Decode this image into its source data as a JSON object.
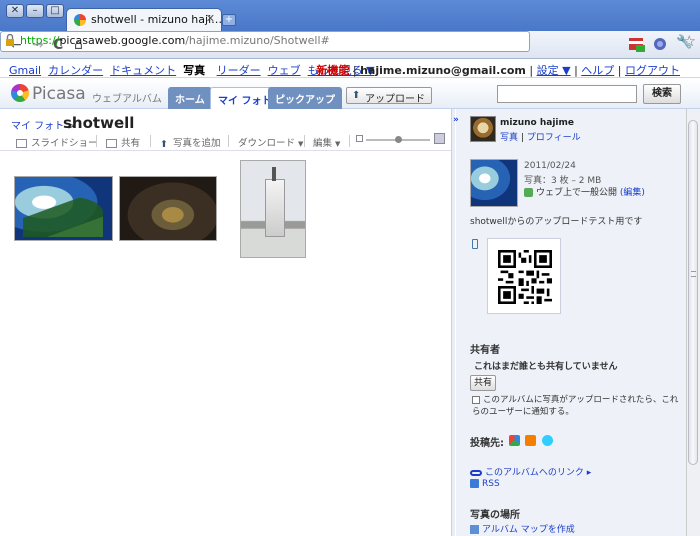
{
  "browser": {
    "tab_title": "shotwell - mizuno haji…",
    "tab_close": "✕",
    "new_tab": "+",
    "win_close": "✕",
    "win_min": "–",
    "win_max": "□",
    "back": "←",
    "forward": "→",
    "reload": "C",
    "home": "⌂",
    "url_scheme": "https://",
    "url_host": "picasaweb.google.com",
    "url_path": "/hajime.mizuno/Shotwell#",
    "star": "☆",
    "wrench": "🔧"
  },
  "gbar": {
    "links": [
      "Gmail",
      "カレンダー",
      "ドキュメント"
    ],
    "current": "写真",
    "links2": [
      "リーダー",
      "ウェブ"
    ],
    "more": "もっと見る ▼",
    "new_features": "新機能",
    "email": "hajime.mizuno@gmail.com",
    "settings": "設定 ▼",
    "help": "ヘルプ",
    "logout": "ログアウト",
    "sep": "|"
  },
  "picasa": {
    "logo_text": "Picasa",
    "subtitle": "ウェブアルバム",
    "tabs": [
      "ホーム",
      "マイ フォト",
      "ピックアップ"
    ],
    "upload_label": "アップロード",
    "upload_icon": "⬆",
    "search_button": "検索",
    "search_value": ""
  },
  "album": {
    "breadcrumb": "マイ フォト",
    "breadcrumb_sep": ">",
    "title": "shotwell",
    "actions": {
      "slideshow": "スライドショー",
      "share": "共有",
      "add_photos": "写真を追加",
      "download": "ダウンロード",
      "edit": "編集"
    },
    "dropdown_arrow": "▼",
    "thumb_size_level": 0.5
  },
  "side": {
    "collapse": "»",
    "owner_name": "mizuno hajime",
    "owner_photos": "写真",
    "owner_profile": "プロフィール",
    "date": "2011/02/24",
    "count": "写真：3 枚 – 2 MB",
    "visibility": "ウェブ上で一般公開",
    "visibility_edit": "(編集)",
    "description": "shotwellからのアップロードテスト用です",
    "sharing_header": "共有者",
    "not_shared": "これはまだ誰とも共有していません",
    "share_button": "共有",
    "notify_text": "このアルバムに写真がアップロードされたら、これらのユーザーに通知する。",
    "post_to": "投稿先:",
    "album_link": "このアルバムへのリンク ▸",
    "rss": "RSS",
    "location_header": "写真の場所",
    "create_map": "アルバム マップを作成"
  },
  "colors": {
    "link": "#1a3ecb",
    "new_features": "#cc0000",
    "url_secure": "#00aa00",
    "chrome_frame": "#4a78c8"
  }
}
